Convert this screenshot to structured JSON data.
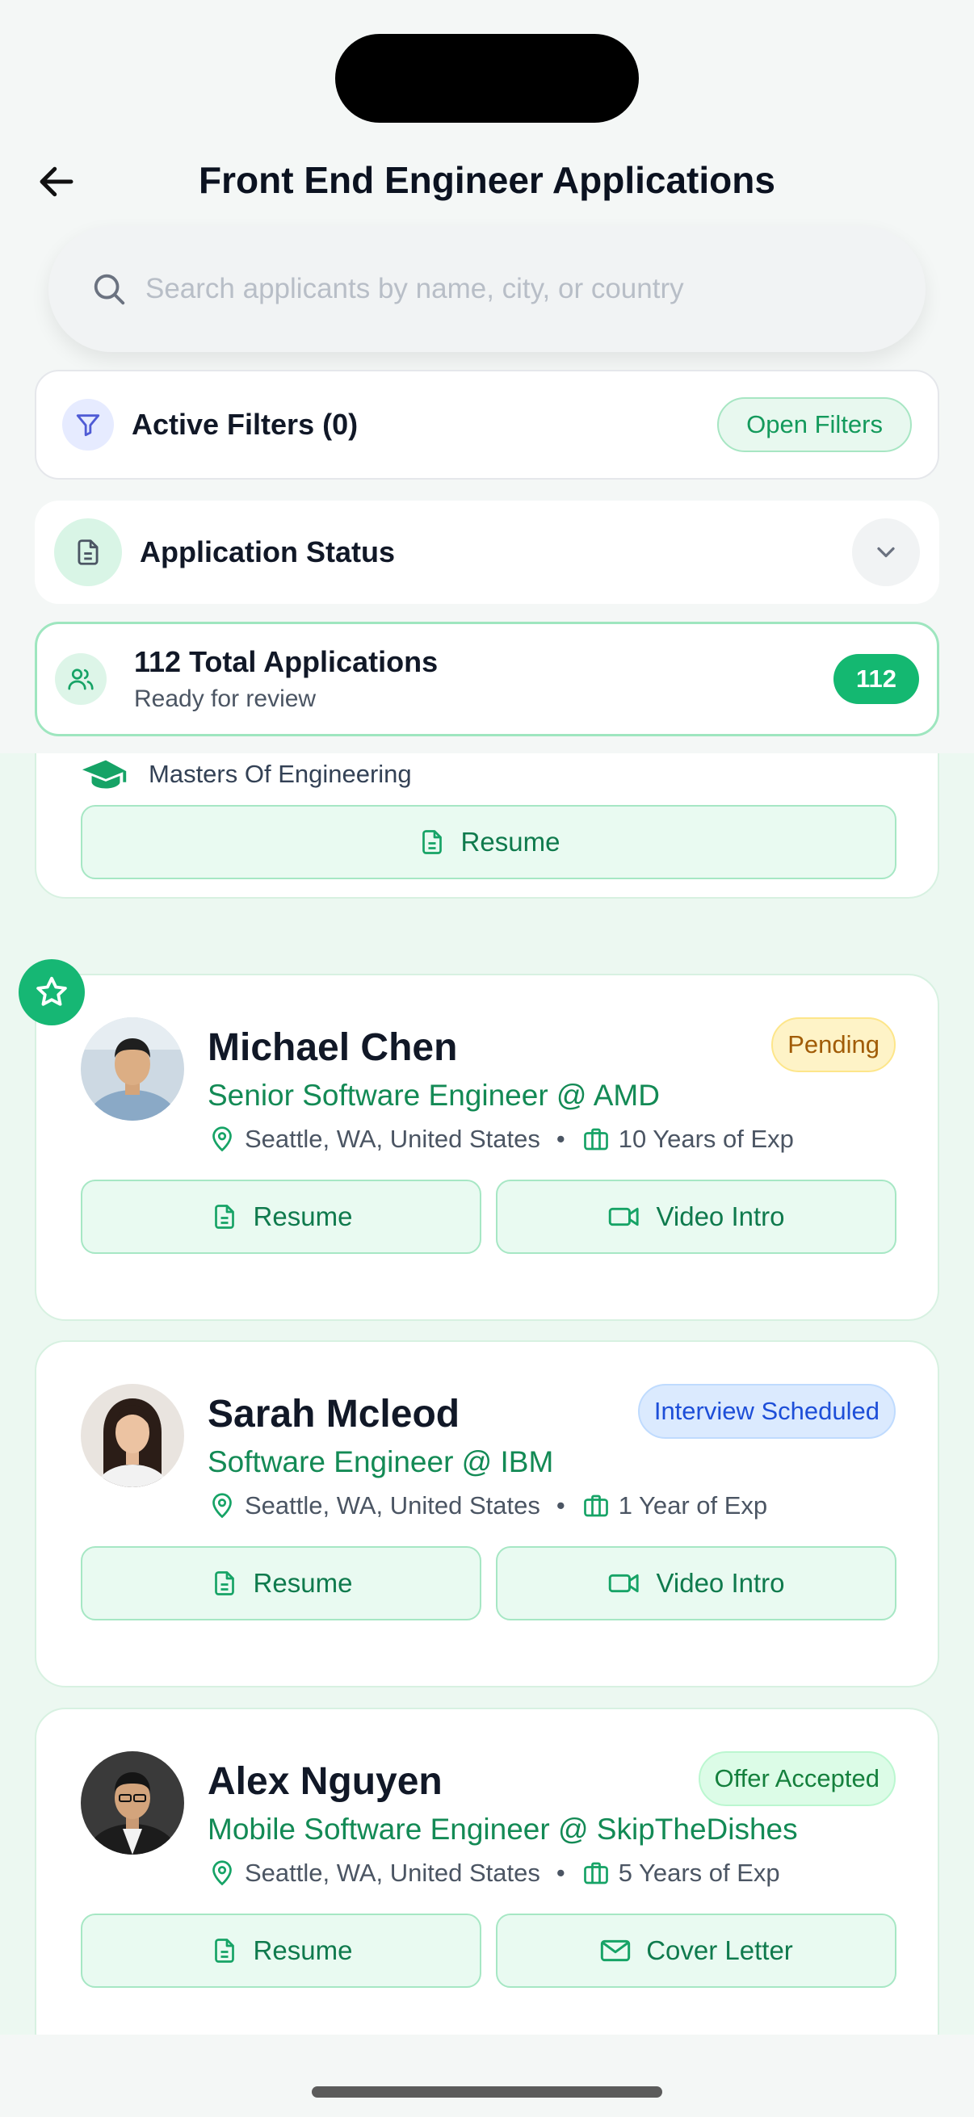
{
  "header": {
    "title": "Front End Engineer Applications"
  },
  "search": {
    "placeholder": "Search applicants by name, city, or country"
  },
  "filters": {
    "label": "Active Filters (0)",
    "open_label": "Open Filters"
  },
  "status": {
    "label": "Application Status"
  },
  "totals": {
    "title": "112 Total Applications",
    "subtitle": "Ready for review",
    "count": "112"
  },
  "partial_card": {
    "education": "Masters Of Engineering",
    "resume_label": "Resume"
  },
  "applicants": [
    {
      "name": "Michael Chen",
      "role": "Senior Software Engineer @ AMD",
      "location": "Seattle, WA, United States",
      "experience": "10 Years of Exp",
      "status": "Pending",
      "buttons": [
        "Resume",
        "Video Intro"
      ],
      "starred": true
    },
    {
      "name": "Sarah Mcleod",
      "role": "Software Engineer @ IBM",
      "location": "Seattle, WA, United States",
      "experience": "1 Year of Exp",
      "status": "Interview Scheduled",
      "buttons": [
        "Resume",
        "Video Intro"
      ],
      "starred": false
    },
    {
      "name": "Alex Nguyen",
      "role": "Mobile Software Engineer @ SkipTheDishes",
      "location": "Seattle, WA, United States",
      "experience": "5 Years of Exp",
      "status": "Offer Accepted",
      "buttons": [
        "Resume",
        "Cover Letter"
      ],
      "starred": false
    }
  ],
  "meta_separator": "•",
  "icons": [
    "arrow-left-icon",
    "search-icon",
    "filter-icon",
    "document-icon",
    "chevron-down-icon",
    "users-icon",
    "graduation-cap-icon",
    "star-icon",
    "map-pin-icon",
    "briefcase-icon",
    "video-icon",
    "mail-icon"
  ],
  "colors": {
    "accent": "#14b871",
    "accent_text": "#0f7a4d",
    "pending": "#a15c07",
    "interview": "#1d4ed8",
    "offer": "#15803d"
  }
}
